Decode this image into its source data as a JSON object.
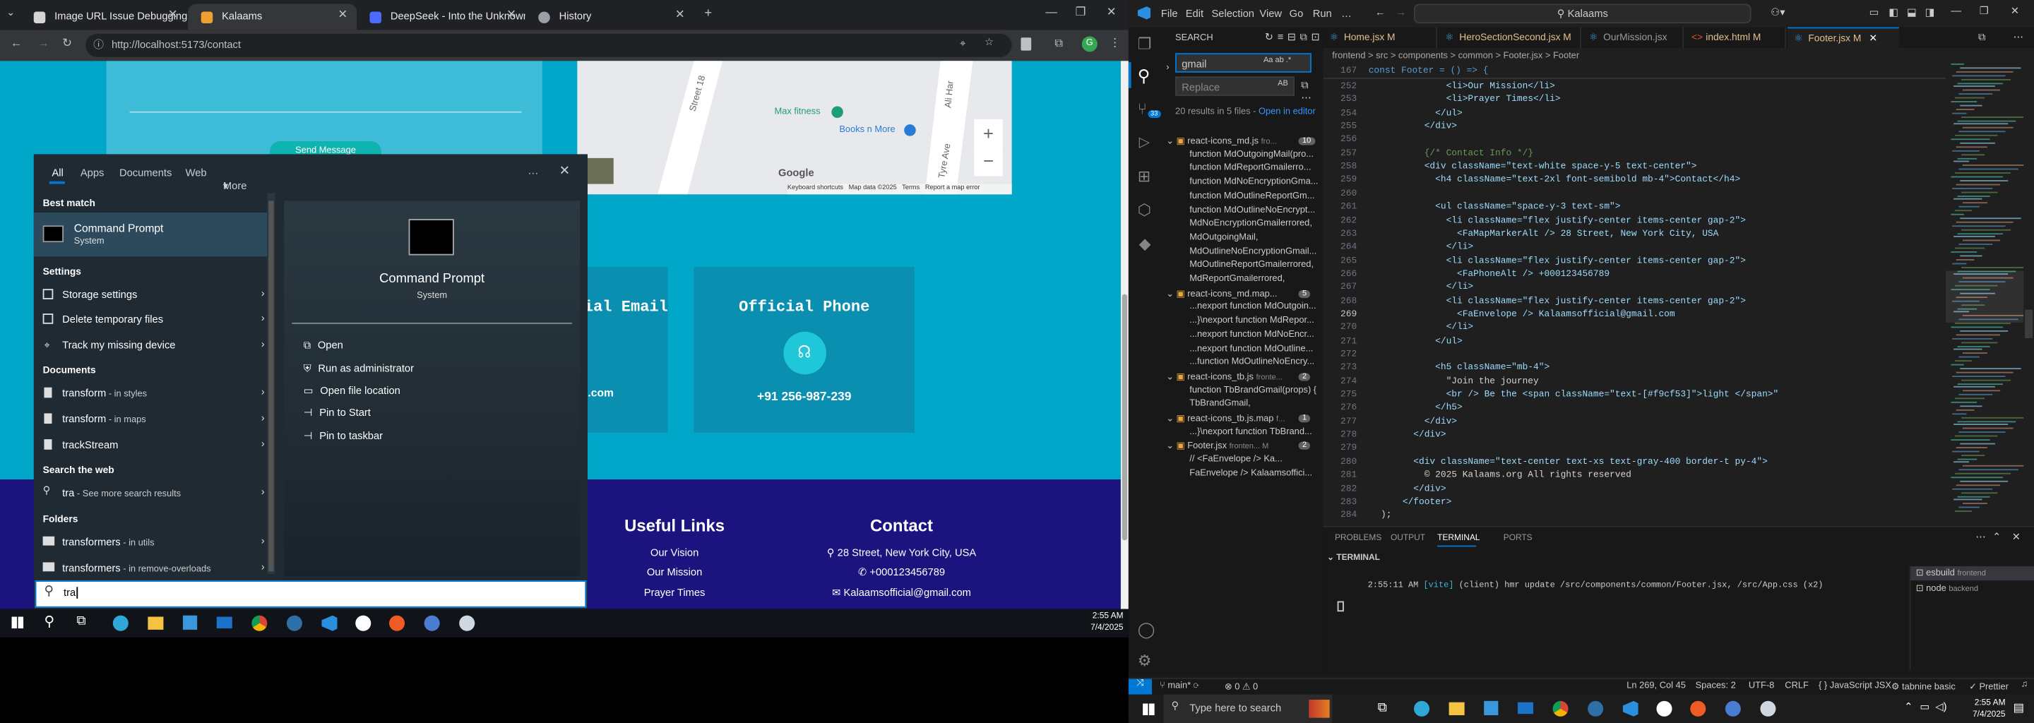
{
  "browser": {
    "tabs": [
      {
        "label": "Image URL Issue Debugging",
        "color": "#d5d5d5",
        "active": false
      },
      {
        "label": "Kalaams",
        "color": "#f0a030",
        "active": true
      },
      {
        "label": "DeepSeek - Into the Unknown",
        "color": "#4d6bfe",
        "active": false
      },
      {
        "label": "History",
        "color": "#9aa0a6",
        "active": false
      }
    ],
    "url": "http://localhost:5173/contact",
    "avatar_letter": "G"
  },
  "website": {
    "send_button": "Send Message",
    "map": {
      "street1": "Street 18",
      "street2": "Ali Har",
      "street3": "Tyre Ave",
      "place1": "Max fitness",
      "place2": "Books n More",
      "zoom_in": "+",
      "zoom_out": "−",
      "google": "Google",
      "credits": "Keyboard shortcuts   Map data ©2025   Terms   Report a map error"
    },
    "email_card_title": "Official Email",
    "email_card_value": "kalaamsofficial@gmail.com",
    "phone_card_title": "Official Phone",
    "phone_card_value": "+91 256-987-239",
    "footer": {
      "links_title": "Useful Links",
      "links": [
        "Our Vision",
        "Our Mission",
        "Prayer Times"
      ],
      "contact_title": "Contact",
      "address": "28 Street, New York City, USA",
      "phone": "+000123456789",
      "email": "Kalaamsofficial@gmail.com"
    }
  },
  "start_menu": {
    "tabs": [
      "All",
      "Apps",
      "Documents",
      "Web",
      "More"
    ],
    "best_match_heading": "Best match",
    "best_match_name": "Command Prompt",
    "best_match_type": "System",
    "settings_heading": "Settings",
    "settings": [
      "Storage settings",
      "Delete temporary files",
      "Track my missing device"
    ],
    "documents_heading": "Documents",
    "documents": [
      {
        "name": "transform",
        "loc": " - in styles"
      },
      {
        "name": "transform",
        "loc": " - in maps"
      },
      {
        "name": "trackStream",
        "loc": ""
      }
    ],
    "web_heading": "Search the web",
    "web_item": "tra",
    "web_suffix": " - See more search results",
    "folders_heading": "Folders",
    "folders": [
      {
        "name": "transformers",
        "loc": " - in utils"
      },
      {
        "name": "transformers",
        "loc": " - in remove-overloads"
      }
    ],
    "preview_name": "Command Prompt",
    "preview_type": "System",
    "actions": [
      "Open",
      "Run as administrator",
      "Open file location",
      "Pin to Start",
      "Pin to taskbar"
    ],
    "search_value": "tra"
  },
  "taskbar_left": {
    "time": "2:55 AM",
    "date": "7/4/2025"
  },
  "vscode": {
    "menu": [
      "File",
      "Edit",
      "Selection",
      "View",
      "Go",
      "Run",
      "…"
    ],
    "title_search": "Kalaams",
    "search_panel_title": "SEARCH",
    "search_value": "gmail",
    "replace_placeholder": "Replace",
    "results_text": "20 results in 5 files - ",
    "open_in_editor": "Open in editor",
    "groups": [
      {
        "file": "react-icons_md.js",
        "path": "fro...",
        "count": "10",
        "lines": [
          "function MdOutgoingMail(pro...",
          "function MdReportGmailerro...",
          "function MdNoEncryptionGma...",
          "function MdOutlineReportGm...",
          "function MdOutlineNoEncrypt...",
          "MdNoEncryptionGmailerrored,",
          "MdOutgoingMail,",
          "MdOutlineNoEncryptionGmail...",
          "MdOutlineReportGmailerrored,",
          "MdReportGmailerrored,"
        ]
      },
      {
        "file": "react-icons_md.map...",
        "path": "",
        "count": "5",
        "lines": [
          "...nexport function MdOutgoin...",
          "...}\\nexport function MdRepor...",
          "...nexport function MdNoEncr...",
          "...nexport function MdOutline...",
          "...function MdOutlineNoEncry..."
        ]
      },
      {
        "file": "react-icons_tb.js",
        "path": "fronte...",
        "count": "2",
        "lines": [
          "function TbBrandGmail(props) {",
          "TbBrandGmail,"
        ]
      },
      {
        "file": "react-icons_tb.js.map",
        "path": "f...",
        "count": "1",
        "lines": [
          "...}\\nexport function TbBrand..."
        ]
      },
      {
        "file": "Footer.jsx",
        "path": "fronten... M",
        "count": "2",
        "lines": [
          "//         <FaEnvelope /> Ka...",
          "FaEnvelope /> Kalaamsoffici..."
        ]
      }
    ],
    "editor_tabs": [
      "Home.jsx M",
      "HeroSectionSecond.jsx M",
      "OurMission.jsx",
      "index.html M",
      "Footer.jsx M"
    ],
    "breadcrumb": "frontend > src > components > common > Footer.jsx > Footer",
    "sticky": {
      "num": "167",
      "text": "const Footer = () => {"
    },
    "code_lines": [
      {
        "n": "252",
        "t": "              <li>Our Mission</li>"
      },
      {
        "n": "253",
        "t": "              <li>Prayer Times</li>"
      },
      {
        "n": "254",
        "t": "            </ul>"
      },
      {
        "n": "255",
        "t": "          </div>"
      },
      {
        "n": "256",
        "t": ""
      },
      {
        "n": "257",
        "t": "          {/* Contact Info */}"
      },
      {
        "n": "258",
        "t": "          <div className=\"text-white space-y-5 text-center\">"
      },
      {
        "n": "259",
        "t": "            <h4 className=\"text-2xl font-semibold mb-4\">Contact</h4>"
      },
      {
        "n": "260",
        "t": ""
      },
      {
        "n": "261",
        "t": "            <ul className=\"space-y-3 text-sm\">"
      },
      {
        "n": "262",
        "t": "              <li className=\"flex justify-center items-center gap-2\">"
      },
      {
        "n": "263",
        "t": "                <FaMapMarkerAlt /> 28 Street, New York City, USA"
      },
      {
        "n": "264",
        "t": "              </li>"
      },
      {
        "n": "265",
        "t": "              <li className=\"flex justify-center items-center gap-2\">"
      },
      {
        "n": "266",
        "t": "                <FaPhoneAlt /> +000123456789"
      },
      {
        "n": "267",
        "t": "              </li>"
      },
      {
        "n": "268",
        "t": "              <li className=\"flex justify-center items-center gap-2\">"
      },
      {
        "n": "269",
        "t": "                <FaEnvelope /> Kalaamsofficial@gmail.com"
      },
      {
        "n": "270",
        "t": "              </li>"
      },
      {
        "n": "271",
        "t": "            </ul>"
      },
      {
        "n": "272",
        "t": ""
      },
      {
        "n": "273",
        "t": "            <h5 className=\"mb-4\">"
      },
      {
        "n": "274",
        "t": "              \"Join the journey"
      },
      {
        "n": "275",
        "t": "              <br /> Be the <span className=\"text-[#f9cf53]\">light </span>\""
      },
      {
        "n": "276",
        "t": "            </h5>"
      },
      {
        "n": "277",
        "t": "          </div>"
      },
      {
        "n": "278",
        "t": "        </div>"
      },
      {
        "n": "279",
        "t": ""
      },
      {
        "n": "280",
        "t": "        <div className=\"text-center text-xs text-gray-400 border-t py-4\">"
      },
      {
        "n": "281",
        "t": "          © 2025 Kalaams.org All rights reserved"
      },
      {
        "n": "282",
        "t": "        </div>"
      },
      {
        "n": "283",
        "t": "      </footer>"
      },
      {
        "n": "284",
        "t": "  );"
      }
    ],
    "panel_tabs": [
      "PROBLEMS",
      "OUTPUT",
      "TERMINAL",
      "PORTS"
    ],
    "terminal_label": "TERMINAL",
    "terminal_time": "2:55:11 AM",
    "terminal_vite": "[vite]",
    "terminal_msg": "(client) hmr update /src/components/common/Footer.jsx, /src/App.css (x2)",
    "terminals": [
      {
        "name": "esbuild",
        "dir": "frontend"
      },
      {
        "name": "node",
        "dir": "backend"
      }
    ],
    "status": {
      "branch": "main*",
      "problems": "⊗ 0 ⚠ 0",
      "cursor": "Ln 269, Col 45",
      "spaces": "Spaces: 2",
      "encoding": "UTF-8",
      "eol": "CRLF",
      "lang": "{ } JavaScript JSX",
      "tabnine": "tabnine basic",
      "prettier": "✓ Prettier"
    }
  },
  "win_taskbar": {
    "search_placeholder": "Type here to search",
    "time": "2:55 AM",
    "date": "7/4/2025"
  }
}
